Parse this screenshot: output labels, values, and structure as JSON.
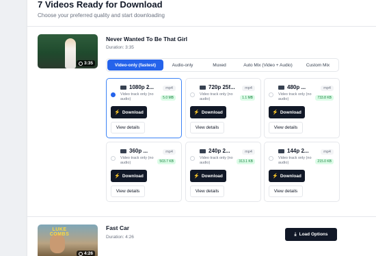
{
  "header": {
    "title": "7 Videos Ready for Download",
    "subtitle": "Choose your preferred quality and start downloading"
  },
  "video1": {
    "title": "Never Wanted To Be That Girl",
    "duration_label": "Duration: 3:35",
    "thumb_duration": "3:35",
    "tabs": [
      "Video-only (fastest)",
      "Audio-only",
      "Muxed",
      "Auto Mix (Video + Audio)",
      "Custom Mix"
    ],
    "options": [
      {
        "quality": "1080p 2...",
        "format": "mp4",
        "desc": "Video track only (no audio)",
        "size": "5.0 MB",
        "selected": true
      },
      {
        "quality": "720p 25f...",
        "format": "mp4",
        "desc": "Video track only (no audio)",
        "size": "1.1 MB",
        "selected": false
      },
      {
        "quality": "480p ...",
        "format": "mp4",
        "desc": "Video track only (no audio)",
        "size": "733.8 KB",
        "selected": false
      },
      {
        "quality": "360p ...",
        "format": "mp4",
        "desc": "Video track only (no audio)",
        "size": "503.7 KB",
        "selected": false
      },
      {
        "quality": "240p 2...",
        "format": "mp4",
        "desc": "Video track only (no audio)",
        "size": "313.1 KB",
        "selected": false
      },
      {
        "quality": "144p 2...",
        "format": "mp4",
        "desc": "Video track only (no audio)",
        "size": "215.0 KB",
        "selected": false
      }
    ],
    "download_label": "Download",
    "details_label": "View details"
  },
  "video2": {
    "title": "Fast Car",
    "duration_label": "Duration: 4:26",
    "thumb_duration": "4:26",
    "thumb_text": "LUKE COMBS",
    "load_label": "Load Options"
  },
  "colors": {
    "accent": "#2563eb",
    "dark_button": "#111827",
    "size_badge_bg": "#dcfce7"
  }
}
